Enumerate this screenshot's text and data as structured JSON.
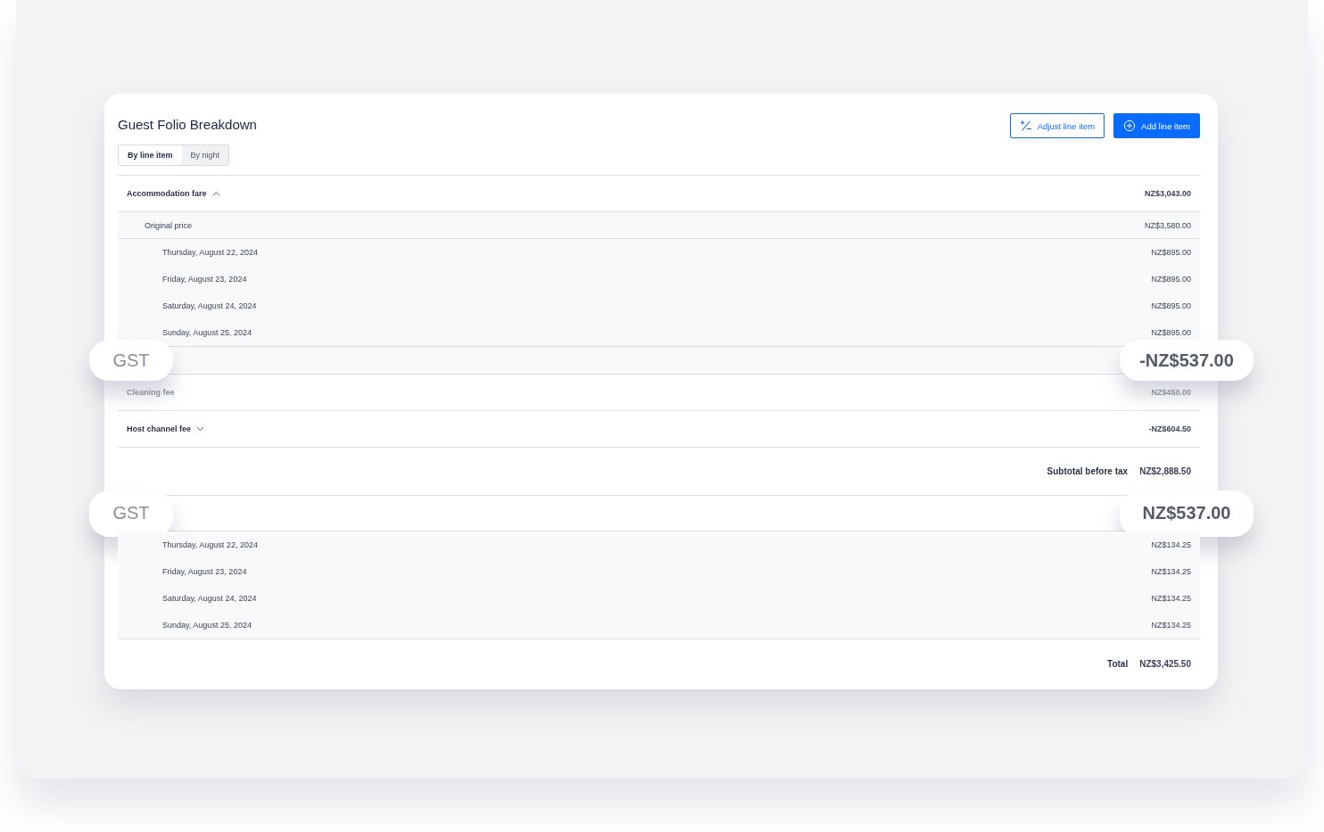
{
  "title": "Guest Folio Breakdown",
  "view_toggle": [
    {
      "label": "By line item",
      "selected": true
    },
    {
      "label": "By night",
      "selected": false
    }
  ],
  "buttons": [
    {
      "label": "Adjust line item",
      "kind": "outline"
    },
    {
      "label": "Add line item",
      "kind": "primary"
    }
  ],
  "rows": [
    {
      "kind": "group",
      "label": "Accommodation fare",
      "amount": "NZ$3,043.00",
      "expanded": true
    },
    {
      "kind": "sub",
      "label": "Original price",
      "amount": "NZ$3,580.00"
    },
    {
      "kind": "night",
      "label": "Thursday, August 22, 2024",
      "amount": "NZ$895.00"
    },
    {
      "kind": "night",
      "label": "Friday, August 23, 2024",
      "amount": "NZ$895.00"
    },
    {
      "kind": "night",
      "label": "Saturday, August 24, 2024",
      "amount": "NZ$895.00"
    },
    {
      "kind": "night",
      "label": "Sunday, August 25, 2024",
      "amount": "NZ$895.00"
    },
    {
      "kind": "callout",
      "label": "GST",
      "amount": "-NZ$537.00"
    },
    {
      "kind": "fee",
      "label": "Cleaning fee",
      "amount": "NZ$450.00"
    },
    {
      "kind": "group",
      "label": "Host channel fee",
      "amount": "-NZ$604.50",
      "expanded": false
    },
    {
      "kind": "subtotal",
      "label": "Subtotal before tax",
      "amount": "NZ$2,888.50"
    },
    {
      "kind": "callout",
      "label": "GST",
      "amount": "NZ$537.00"
    },
    {
      "kind": "night",
      "label": "Thursday, August 22, 2024",
      "amount": "NZ$134.25"
    },
    {
      "kind": "night",
      "label": "Friday, August 23, 2024",
      "amount": "NZ$134.25"
    },
    {
      "kind": "night",
      "label": "Saturday, August 24, 2024",
      "amount": "NZ$134.25"
    },
    {
      "kind": "night",
      "label": "Sunday, August 25, 2024",
      "amount": "NZ$134.25"
    },
    {
      "kind": "total",
      "label": "Total",
      "amount": "NZ$3,425.50"
    }
  ]
}
